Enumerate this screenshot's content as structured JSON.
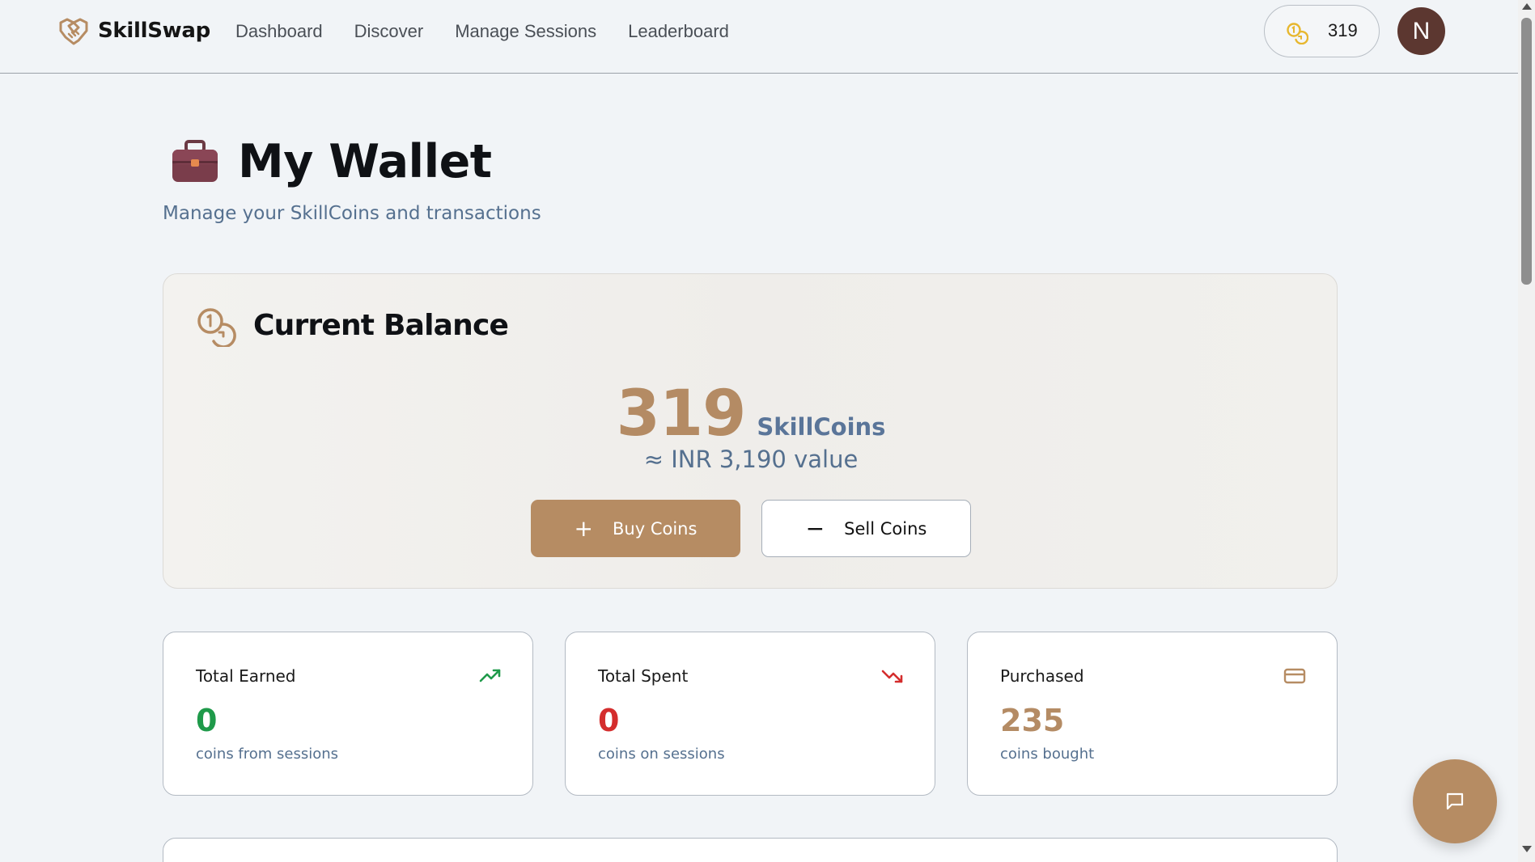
{
  "header": {
    "brand": "SkillSwap",
    "nav": [
      {
        "label": "Dashboard"
      },
      {
        "label": "Discover"
      },
      {
        "label": "Manage Sessions"
      },
      {
        "label": "Leaderboard"
      }
    ],
    "coin_balance": "319",
    "avatar_initial": "N"
  },
  "page": {
    "title": "My Wallet",
    "subtitle": "Manage your SkillCoins and transactions"
  },
  "balance_card": {
    "title": "Current Balance",
    "amount": "319",
    "unit": "SkillCoins",
    "inr_value": "≈ INR 3,190 value",
    "buy_label": "Buy Coins",
    "sell_label": "Sell Coins"
  },
  "stats": [
    {
      "label": "Total Earned",
      "value": "0",
      "sub": "coins from sessions",
      "icon": "trending-up-icon",
      "color": "#1f9a4a"
    },
    {
      "label": "Total Spent",
      "value": "0",
      "sub": "coins on sessions",
      "icon": "trending-down-icon",
      "color": "#d42d2d"
    },
    {
      "label": "Purchased",
      "value": "235",
      "sub": "coins bought",
      "icon": "credit-card-icon",
      "color": "#b48b64"
    }
  ],
  "colors": {
    "accent": "#b68c63",
    "background": "#f1f4f7",
    "muted_text": "#55708f",
    "avatar": "#5c3730"
  }
}
